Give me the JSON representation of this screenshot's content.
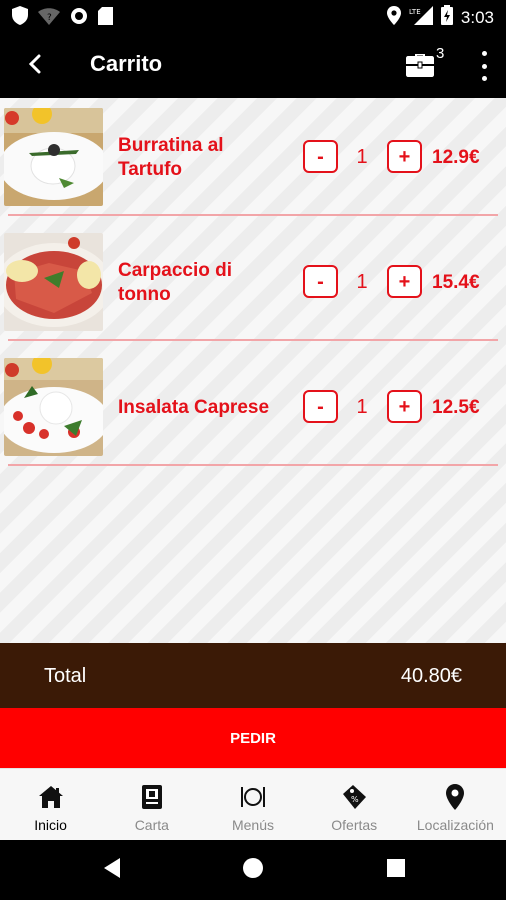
{
  "status_bar": {
    "time": "3:03",
    "icons": [
      "shield-icon",
      "wifi-icon",
      "circle-icon",
      "sd-card-icon",
      "location-icon",
      "signal-lte-icon",
      "battery-icon"
    ],
    "network": "LTE"
  },
  "app_bar": {
    "title": "Carrito",
    "back_icon": "arrow-back-icon",
    "cart_icon": "briefcase-icon",
    "cart_count": "3",
    "more_icon": "more-vert-icon"
  },
  "cart": {
    "items": [
      {
        "name": "Burratina al Tartufo",
        "quantity": "1",
        "price": "12.9€",
        "minus_label": "-",
        "plus_label": "+"
      },
      {
        "name": "Carpaccio di tonno",
        "quantity": "1",
        "price": "15.4€",
        "minus_label": "-",
        "plus_label": "+"
      },
      {
        "name": "Insalata Caprese",
        "quantity": "1",
        "price": "12.5€",
        "minus_label": "-",
        "plus_label": "+"
      }
    ]
  },
  "total": {
    "label": "Total",
    "value": "40.80€"
  },
  "order_button": {
    "label": "PEDIR"
  },
  "bottom_nav": {
    "items": [
      {
        "label": "Inicio",
        "icon": "home-icon",
        "active": true
      },
      {
        "label": "Carta",
        "icon": "menu-card-icon",
        "active": false
      },
      {
        "label": "Menús",
        "icon": "cutlery-plate-icon",
        "active": false
      },
      {
        "label": "Ofertas",
        "icon": "offer-tag-icon",
        "active": false
      },
      {
        "label": "Localización",
        "icon": "location-pin-icon",
        "active": false
      }
    ]
  },
  "system_nav": {
    "icons": [
      "back-triangle-icon",
      "home-circle-icon",
      "recents-square-icon"
    ]
  },
  "colors": {
    "accent": "#e4111a",
    "total_bar": "#3b1a06",
    "order_button": "#ff0000",
    "app_bar": "#000000"
  }
}
